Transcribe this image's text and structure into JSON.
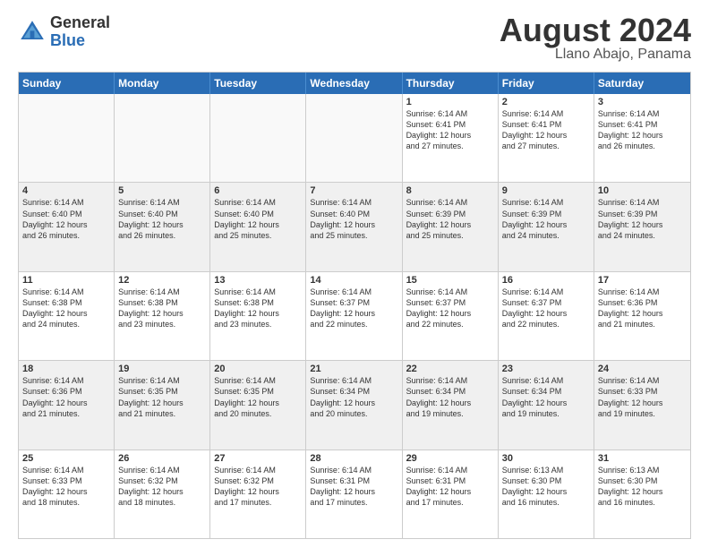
{
  "header": {
    "logo_general": "General",
    "logo_blue": "Blue",
    "month_title": "August 2024",
    "location": "Llano Abajo, Panama"
  },
  "calendar": {
    "days_of_week": [
      "Sunday",
      "Monday",
      "Tuesday",
      "Wednesday",
      "Thursday",
      "Friday",
      "Saturday"
    ],
    "rows": [
      [
        {
          "day": "",
          "info": "",
          "empty": true
        },
        {
          "day": "",
          "info": "",
          "empty": true
        },
        {
          "day": "",
          "info": "",
          "empty": true
        },
        {
          "day": "",
          "info": "",
          "empty": true
        },
        {
          "day": "1",
          "info": "Sunrise: 6:14 AM\nSunset: 6:41 PM\nDaylight: 12 hours\nand 27 minutes."
        },
        {
          "day": "2",
          "info": "Sunrise: 6:14 AM\nSunset: 6:41 PM\nDaylight: 12 hours\nand 27 minutes."
        },
        {
          "day": "3",
          "info": "Sunrise: 6:14 AM\nSunset: 6:41 PM\nDaylight: 12 hours\nand 26 minutes."
        }
      ],
      [
        {
          "day": "4",
          "info": "Sunrise: 6:14 AM\nSunset: 6:40 PM\nDaylight: 12 hours\nand 26 minutes."
        },
        {
          "day": "5",
          "info": "Sunrise: 6:14 AM\nSunset: 6:40 PM\nDaylight: 12 hours\nand 26 minutes."
        },
        {
          "day": "6",
          "info": "Sunrise: 6:14 AM\nSunset: 6:40 PM\nDaylight: 12 hours\nand 25 minutes."
        },
        {
          "day": "7",
          "info": "Sunrise: 6:14 AM\nSunset: 6:40 PM\nDaylight: 12 hours\nand 25 minutes."
        },
        {
          "day": "8",
          "info": "Sunrise: 6:14 AM\nSunset: 6:39 PM\nDaylight: 12 hours\nand 25 minutes."
        },
        {
          "day": "9",
          "info": "Sunrise: 6:14 AM\nSunset: 6:39 PM\nDaylight: 12 hours\nand 24 minutes."
        },
        {
          "day": "10",
          "info": "Sunrise: 6:14 AM\nSunset: 6:39 PM\nDaylight: 12 hours\nand 24 minutes."
        }
      ],
      [
        {
          "day": "11",
          "info": "Sunrise: 6:14 AM\nSunset: 6:38 PM\nDaylight: 12 hours\nand 24 minutes."
        },
        {
          "day": "12",
          "info": "Sunrise: 6:14 AM\nSunset: 6:38 PM\nDaylight: 12 hours\nand 23 minutes."
        },
        {
          "day": "13",
          "info": "Sunrise: 6:14 AM\nSunset: 6:38 PM\nDaylight: 12 hours\nand 23 minutes."
        },
        {
          "day": "14",
          "info": "Sunrise: 6:14 AM\nSunset: 6:37 PM\nDaylight: 12 hours\nand 22 minutes."
        },
        {
          "day": "15",
          "info": "Sunrise: 6:14 AM\nSunset: 6:37 PM\nDaylight: 12 hours\nand 22 minutes."
        },
        {
          "day": "16",
          "info": "Sunrise: 6:14 AM\nSunset: 6:37 PM\nDaylight: 12 hours\nand 22 minutes."
        },
        {
          "day": "17",
          "info": "Sunrise: 6:14 AM\nSunset: 6:36 PM\nDaylight: 12 hours\nand 21 minutes."
        }
      ],
      [
        {
          "day": "18",
          "info": "Sunrise: 6:14 AM\nSunset: 6:36 PM\nDaylight: 12 hours\nand 21 minutes."
        },
        {
          "day": "19",
          "info": "Sunrise: 6:14 AM\nSunset: 6:35 PM\nDaylight: 12 hours\nand 21 minutes."
        },
        {
          "day": "20",
          "info": "Sunrise: 6:14 AM\nSunset: 6:35 PM\nDaylight: 12 hours\nand 20 minutes."
        },
        {
          "day": "21",
          "info": "Sunrise: 6:14 AM\nSunset: 6:34 PM\nDaylight: 12 hours\nand 20 minutes."
        },
        {
          "day": "22",
          "info": "Sunrise: 6:14 AM\nSunset: 6:34 PM\nDaylight: 12 hours\nand 19 minutes."
        },
        {
          "day": "23",
          "info": "Sunrise: 6:14 AM\nSunset: 6:34 PM\nDaylight: 12 hours\nand 19 minutes."
        },
        {
          "day": "24",
          "info": "Sunrise: 6:14 AM\nSunset: 6:33 PM\nDaylight: 12 hours\nand 19 minutes."
        }
      ],
      [
        {
          "day": "25",
          "info": "Sunrise: 6:14 AM\nSunset: 6:33 PM\nDaylight: 12 hours\nand 18 minutes."
        },
        {
          "day": "26",
          "info": "Sunrise: 6:14 AM\nSunset: 6:32 PM\nDaylight: 12 hours\nand 18 minutes."
        },
        {
          "day": "27",
          "info": "Sunrise: 6:14 AM\nSunset: 6:32 PM\nDaylight: 12 hours\nand 17 minutes."
        },
        {
          "day": "28",
          "info": "Sunrise: 6:14 AM\nSunset: 6:31 PM\nDaylight: 12 hours\nand 17 minutes."
        },
        {
          "day": "29",
          "info": "Sunrise: 6:14 AM\nSunset: 6:31 PM\nDaylight: 12 hours\nand 17 minutes."
        },
        {
          "day": "30",
          "info": "Sunrise: 6:13 AM\nSunset: 6:30 PM\nDaylight: 12 hours\nand 16 minutes."
        },
        {
          "day": "31",
          "info": "Sunrise: 6:13 AM\nSunset: 6:30 PM\nDaylight: 12 hours\nand 16 minutes."
        }
      ]
    ]
  }
}
